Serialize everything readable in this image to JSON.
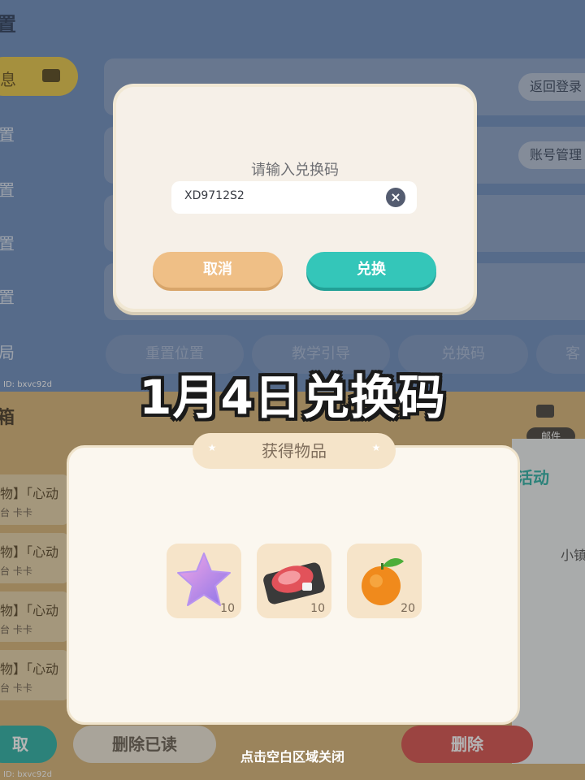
{
  "background": {
    "top_title": "置",
    "sidebar_active": "息",
    "sidebar_items": [
      "置",
      "置",
      "置",
      "置",
      "局"
    ],
    "settings_buttons": [
      "返回登录",
      "账号管理"
    ],
    "bottom_tabs": [
      "重置位置",
      "教学引导",
      "兑换码",
      "客"
    ],
    "uid_top": "ID: bxvc92d",
    "uid_bottom": "ID: bxvc92d",
    "mail_section_title": "箱",
    "mail_items": [
      {
        "line1": "物】「心动",
        "line2": "台 卡卡"
      },
      {
        "line1": "物】「心动",
        "line2": "台 卡卡"
      },
      {
        "line1": "物】「心动",
        "line2": "台 卡卡"
      },
      {
        "line1": "物】「心动",
        "line2": "台 卡卡"
      }
    ],
    "mail_tag": "邮件",
    "activity_label": "活动",
    "town_label": "小镇",
    "buttons": {
      "claim": "取",
      "delete_read": "删除已读",
      "delete": "删除"
    }
  },
  "redeem_dialog": {
    "title": "请输入兑换码",
    "code_value": "XD9712S2",
    "cancel_label": "取消",
    "redeem_label": "兑换"
  },
  "headline": "1月4日兑换码",
  "reward_panel": {
    "title": "获得物品",
    "items": [
      {
        "icon": "purple-star-icon",
        "count": "10"
      },
      {
        "icon": "steak-icon",
        "count": "10"
      },
      {
        "icon": "tangerine-icon",
        "count": "20"
      }
    ]
  },
  "close_hint": "点击空白区域关闭",
  "colors": {
    "accent_teal": "#34c6b9",
    "accent_orange": "#efbf86",
    "panel_cream": "#fbf7ef",
    "delete_red": "#d9534f"
  }
}
